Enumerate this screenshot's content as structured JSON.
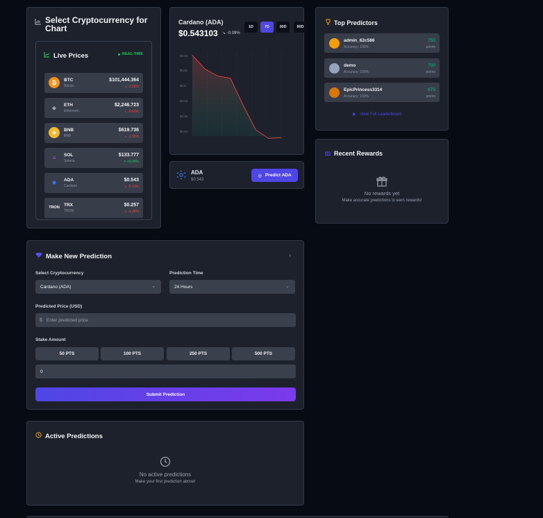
{
  "select_card": {
    "title": "Select Cryptocurrency for Chart",
    "live_prices_label": "Live Prices",
    "realtime_label": "REAL-TIME",
    "coins": [
      {
        "symbol": "BTC",
        "name": "Bitcoin",
        "price": "$101,444.364",
        "change": "-1.02%",
        "direction": "down",
        "color": "#f7931a",
        "glyph": "₿"
      },
      {
        "symbol": "ETH",
        "name": "Ethereum",
        "price": "$2,246.723",
        "change": "-0.60%",
        "direction": "down",
        "color": "#373d49",
        "glyph": "◆"
      },
      {
        "symbol": "BNB",
        "name": "BNB",
        "price": "$619.736",
        "change": "-1.55%",
        "direction": "down",
        "color": "#f3ba2f",
        "glyph": "❖"
      },
      {
        "symbol": "SOL",
        "name": "Solana",
        "price": "$133.777",
        "change": "+0.45%",
        "direction": "up",
        "color": "#373d49",
        "glyph": "≡"
      },
      {
        "symbol": "ADA",
        "name": "Cardano",
        "price": "$0.543",
        "change": "-0.10%",
        "direction": "down",
        "color": "#373d49",
        "glyph": "✺"
      },
      {
        "symbol": "TRX",
        "name": "TRON",
        "price": "$0.257",
        "change": "-3.28%",
        "direction": "down",
        "color": "#373d49",
        "glyph": "TRON"
      }
    ]
  },
  "chart_card": {
    "title": "Cardano (ADA)",
    "price": "$0.543103",
    "change": "-0.09%",
    "timeframes": [
      "1D",
      "7D",
      "30D",
      "90D"
    ],
    "active_timeframe": "7D"
  },
  "chart_data": {
    "type": "area",
    "title": "",
    "xlabel": "",
    "ylabel": "",
    "yticks": [
      "$0.63",
      "$0.62",
      "$0.6",
      "$0.58",
      "$0.56",
      "$0.54"
    ],
    "ylim": [
      0.53,
      0.64
    ],
    "series": [
      {
        "values": [
          0.635,
          0.617,
          0.608,
          0.605,
          0.57,
          0.538,
          0.527,
          0.528
        ],
        "color": "#ef4444"
      }
    ]
  },
  "ada_bar": {
    "name": "ADA",
    "price": "$0.543",
    "predict_label": "Predict ADA"
  },
  "top_predictors": {
    "title": "Top Predictors",
    "items": [
      {
        "name": "admin_62c586",
        "accuracy": "Accuracy: 100%",
        "points": "750",
        "points_label": "points",
        "avatar_color": "#f59e0b"
      },
      {
        "name": "demo",
        "accuracy": "Accuracy: 100%",
        "points": "700",
        "points_label": "points",
        "avatar_color": "#94a3b8"
      },
      {
        "name": "EpicPrincess3314",
        "accuracy": "Accuracy: 100%",
        "points": "675",
        "points_label": "points",
        "avatar_color": "#d97706"
      }
    ],
    "view_all_label": "View Full Leaderboard"
  },
  "rewards": {
    "title": "Recent Rewards",
    "empty_title": "No rewards yet",
    "empty_sub": "Make accurate predictions to earn rewards!"
  },
  "make_prediction": {
    "title": "Make New Prediction",
    "crypto_label": "Select Cryptocurrency",
    "crypto_value": "Cardano (ADA)",
    "time_label": "Prediction Time",
    "time_value": "24 Hours",
    "price_label": "Predicted Price (USD)",
    "price_prefix": "$",
    "price_placeholder": "Enter predicted price",
    "stake_label": "Stake Amount",
    "stake_options": [
      "50 PTS",
      "100 PTS",
      "250 PTS",
      "500 PTS"
    ],
    "stake_value": "0",
    "submit_label": "Submit Prediction"
  },
  "active_predictions": {
    "title": "Active Predictions",
    "empty_title": "No active predictions",
    "empty_sub": "Make your first prediction above!"
  },
  "colors": {
    "accent": "#4f46e5",
    "positive": "#22c55e",
    "negative": "#ef4444",
    "card_bg": "#1c212c",
    "page_bg": "#070b14"
  }
}
